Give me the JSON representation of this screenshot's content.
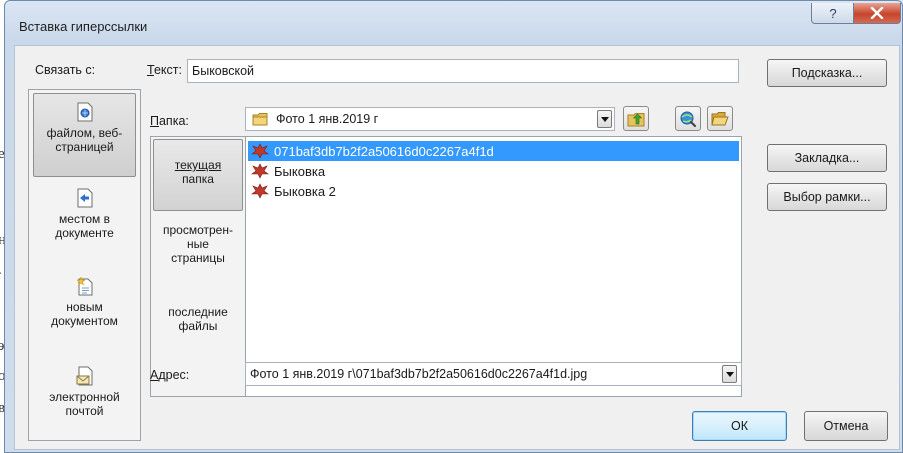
{
  "window": {
    "title": "Вставка гиперссылки",
    "help_glyph": "?",
    "close_glyph": "x"
  },
  "link_to": {
    "label": "Связать с:",
    "items": [
      {
        "line1": "файлом, веб-",
        "line2": "страницей",
        "icon": "existing-file-icon",
        "selected": true
      },
      {
        "line1": "местом в",
        "line2": "документе",
        "icon": "place-in-document-icon",
        "selected": false
      },
      {
        "line1": "новым",
        "line2": "документом",
        "icon": "new-document-icon",
        "selected": false
      },
      {
        "line1": "электронной",
        "line2": "почтой",
        "icon": "email-icon",
        "selected": false
      }
    ]
  },
  "text_field": {
    "label": "Текст:",
    "value": "Быковской"
  },
  "screentip_button": "Подсказка...",
  "folder": {
    "label": "Папка:",
    "value": "Фото 1 янв.2019 г"
  },
  "view_tabs": [
    {
      "line1": "текущая",
      "line2": "папка",
      "line3": "",
      "selected": true
    },
    {
      "line1": "просмотрен-",
      "line2": "ные",
      "line3": "страницы",
      "selected": false
    },
    {
      "line1": "последние",
      "line2": "файлы",
      "line3": "",
      "selected": false
    }
  ],
  "files": [
    {
      "name": "071baf3db7b2f2a50616d0c2267a4f1d",
      "selected": true
    },
    {
      "name": "Быковка",
      "selected": false
    },
    {
      "name": "Быковка 2",
      "selected": false
    }
  ],
  "bookmark_button": "Закладка...",
  "frame_button": "Выбор рамки...",
  "address": {
    "label": "Адрес:",
    "value": "Фото 1 янв.2019 г\\071baf3db7b2f2a50616d0c2267a4f1d.jpg"
  },
  "ok_button": "ОК",
  "cancel_button": "Отмена",
  "background_letters": [
    "е",
    "н",
    ".",
    "э",
    "о",
    "в"
  ],
  "colors": {
    "selection": "#3399ff",
    "close_button": "#c7442c",
    "window_frame": "#dbe6f4"
  }
}
